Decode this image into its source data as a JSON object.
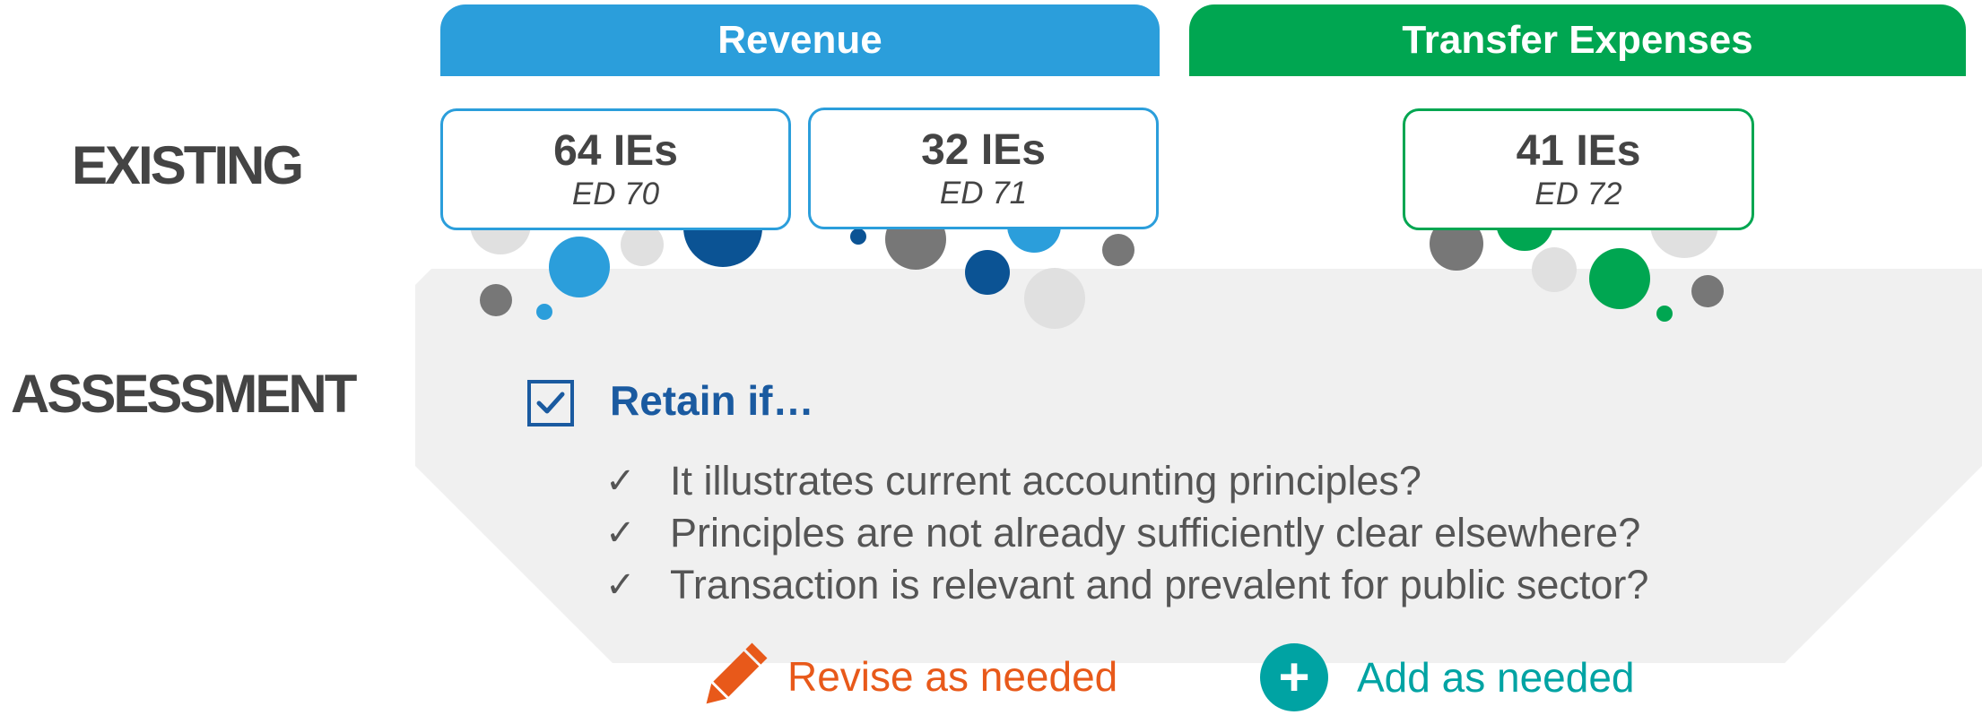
{
  "categories": {
    "revenue": {
      "label": "Revenue",
      "color": "#2b9edb"
    },
    "transfer": {
      "label": "Transfer Expenses",
      "color": "#00a651"
    }
  },
  "rows": {
    "existing": "EXISTING",
    "assessment": "ASSESSMENT"
  },
  "ie_boxes": [
    {
      "count": "64 IEs",
      "ed": "ED 70"
    },
    {
      "count": "32 IEs",
      "ed": "ED 71"
    },
    {
      "count": "41 IEs",
      "ed": "ED 72"
    }
  ],
  "assessment": {
    "retain_title": "Retain if…",
    "criteria": [
      "It illustrates current accounting principles?",
      "Principles are not already sufficiently clear elsewhere?",
      "Transaction is relevant and prevalent for public sector?"
    ],
    "revise_label": "Revise as needed",
    "add_label": "Add as needed"
  },
  "colors": {
    "revenue_blue": "#2b9edb",
    "dark_blue": "#0b5394",
    "transfer_green": "#00a651",
    "revise_orange": "#e8591a",
    "add_teal": "#00a3a3",
    "panel_gray": "#f0f0f0"
  }
}
